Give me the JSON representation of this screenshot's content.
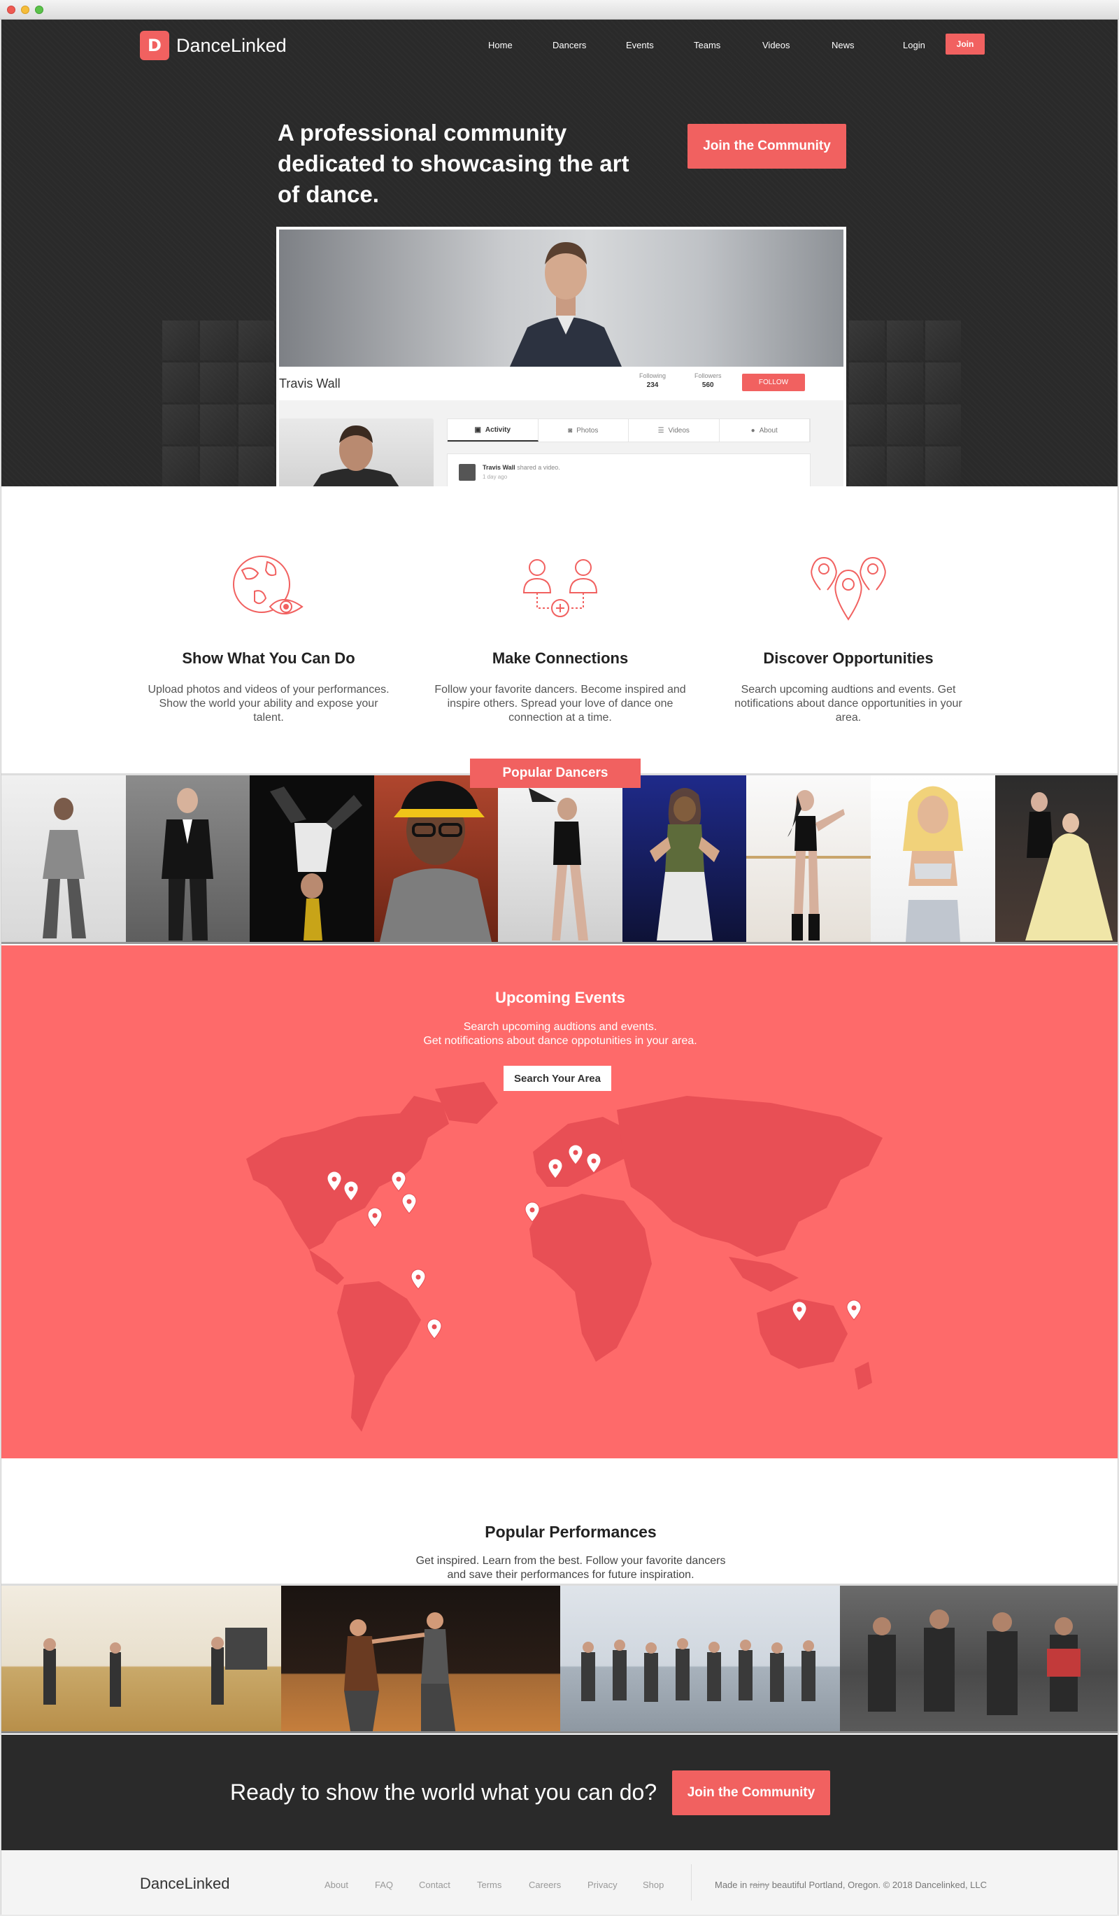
{
  "brand": {
    "name": "DanceLinked",
    "logo_mark": "D",
    "accent": "#f16160"
  },
  "nav": {
    "items": [
      "Home",
      "Dancers",
      "Events",
      "Teams",
      "Videos",
      "News"
    ],
    "login": "Login",
    "join": "Join"
  },
  "hero": {
    "title": "A professional community dedicated to showcasing the art of dance.",
    "cta": "Join the Community"
  },
  "profile_mock": {
    "name": "Travis Wall",
    "following_label": "Following",
    "following_value": "234",
    "followers_label": "Followers",
    "followers_value": "560",
    "follow_button": "FOLLOW",
    "tabs": [
      "Activity",
      "Photos",
      "Videos",
      "About"
    ],
    "feed_user": "Travis Wall",
    "feed_action": "shared a video.",
    "feed_time": "1 day ago"
  },
  "features": [
    {
      "icon": "globe-eye-icon",
      "title": "Show What You Can Do",
      "text": "Upload photos and videos of your performances. Show the world your ability and expose your talent."
    },
    {
      "icon": "connect-people-icon",
      "title": "Make Connections",
      "text": "Follow your favorite dancers. Become inspired and inspire others. Spread your love of dance one connection at a time."
    },
    {
      "icon": "map-pins-icon",
      "title": "Discover Opportunities",
      "text": "Search upcoming audtions and events. Get notifications about dance opportunities in your area."
    }
  ],
  "popular_dancers": {
    "label": "Popular Dancers"
  },
  "events": {
    "title": "Upcoming Events",
    "line1": "Search upcoming audtions and events.",
    "line2": "Get notifications about dance oppotunities in your area.",
    "button": "Search Your Area",
    "bg_color": "#fe6a6a"
  },
  "performances": {
    "title": "Popular Performances",
    "line1": "Get inspired. Learn from the best. Follow your favorite dancers",
    "line2": "and save their performances for future inspiration."
  },
  "cta_band": {
    "text": "Ready to show the world what you can do?",
    "button": "Join the Community"
  },
  "footer": {
    "logo": "DanceLinked",
    "links": [
      "About",
      "FAQ",
      "Contact",
      "Terms",
      "Careers",
      "Privacy",
      "Shop"
    ],
    "copy_prefix": "Made in",
    "copy_struck": "rainy",
    "copy_suffix": "beautiful Portland, Oregon. © 2018 Dancelinked, LLC"
  }
}
